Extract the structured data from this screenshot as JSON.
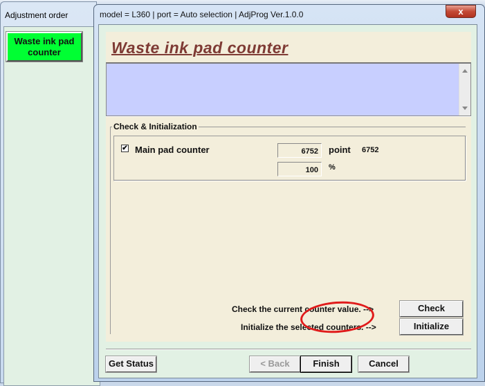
{
  "left_window": {
    "title": "Adjustment order",
    "items": [
      {
        "label": "Waste ink pad counter"
      }
    ],
    "accent": "#00ff33"
  },
  "dialog": {
    "title": "model = L360 | port = Auto selection | AdjProg Ver.1.0.0",
    "close_label": "x",
    "heading": "Waste ink pad counter",
    "group_label": "Check & Initialization",
    "counters": [
      {
        "checked": true,
        "check_mark": "✔",
        "label": "Main pad counter",
        "value": "6752",
        "unit": "point",
        "raw": "6752",
        "percent": "100",
        "percent_unit": "%"
      }
    ],
    "check_instruction": "Check the current counter value. -->",
    "check_label": "Check",
    "init_instruction": "Initialize the selected counters. -->",
    "init_label": "Initialize",
    "get_status_label": "Get Status",
    "back_label": "< Back",
    "finish_label": "Finish",
    "cancel_label": "Cancel",
    "heading_color": "#7e3a34",
    "annotation_color": "#e01b1b"
  }
}
